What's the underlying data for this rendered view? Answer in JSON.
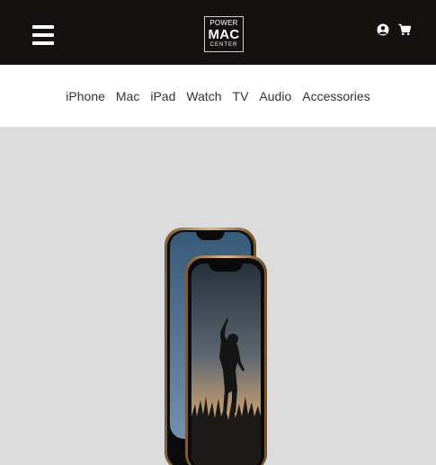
{
  "header": {
    "logo": {
      "line1": "POWER",
      "line2": "MAC",
      "line3": "CENTER"
    },
    "icons": [
      "menu-icon",
      "user-icon",
      "cart-icon"
    ]
  },
  "nav": {
    "items": [
      "iPhone",
      "Mac",
      "iPad",
      "Watch",
      "TV",
      "Audio",
      "Accessories"
    ]
  },
  "hero": {
    "background": "#dcdcdc"
  },
  "colors": {
    "topbar": "#141110",
    "nav_text": "#333333"
  }
}
